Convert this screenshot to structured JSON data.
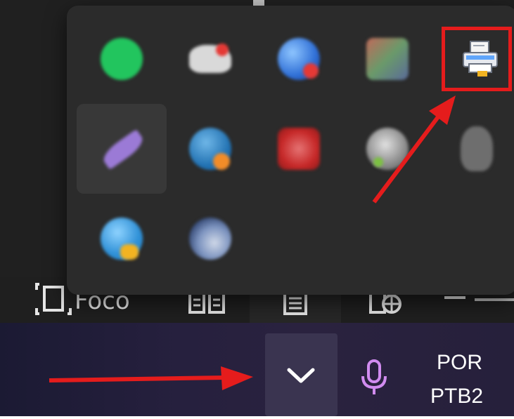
{
  "statusbar": {
    "focus_label": "Foco"
  },
  "taskbar": {
    "language_line1": "POR",
    "language_line2": "PTB2",
    "chevron_icon": "chevron-up-icon",
    "mic_icon": "microphone-icon"
  },
  "tray_popup": {
    "icons": [
      {
        "name": "green-app-icon",
        "color": "#22c55e"
      },
      {
        "name": "cloud-app-icon",
        "color": "#d9d9d9"
      },
      {
        "name": "blue-red-app-icon",
        "color": "#2f6fd6"
      },
      {
        "name": "colorful-square-app-icon",
        "color": "#7a8f6f"
      },
      {
        "name": "printer-icon",
        "color": "#e6e9ef"
      },
      {
        "name": "purple-feather-app-icon",
        "color": "#9b7ad6"
      },
      {
        "name": "blue-orange-app-icon",
        "color": "#1f6fb0"
      },
      {
        "name": "red-app-icon",
        "color": "#c62828"
      },
      {
        "name": "gray-green-app-icon",
        "color": "#8a8a8a"
      },
      {
        "name": "gray-ghost-app-icon",
        "color": "#777777"
      },
      {
        "name": "blue-yellow-app-icon",
        "color": "#2d8fd6"
      },
      {
        "name": "dark-blue-app-icon",
        "color": "#2a3e6a"
      }
    ]
  },
  "colors": {
    "annotation_red": "#e51c1c",
    "popup_bg": "#2b2b2b",
    "taskbar_bg": "#241f3b"
  }
}
